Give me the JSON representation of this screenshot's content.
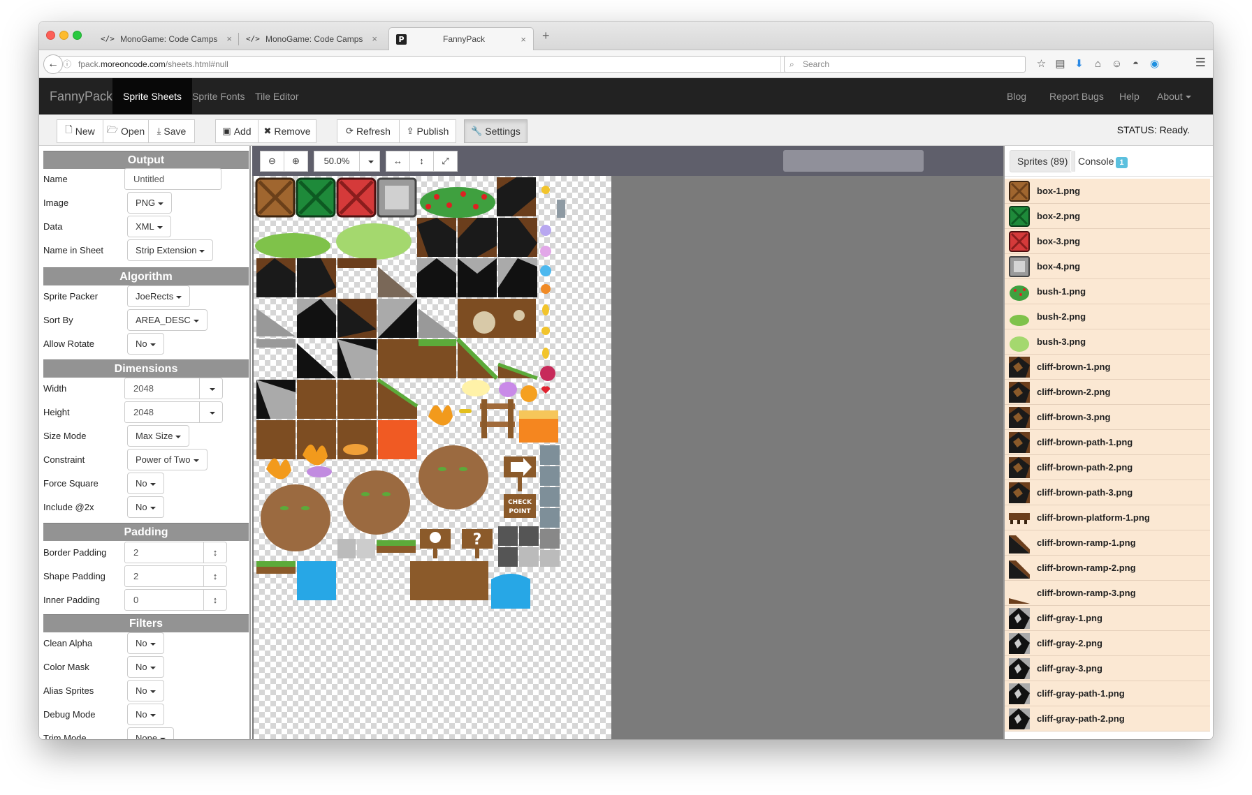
{
  "browser": {
    "tabs": [
      {
        "favicon": "</>",
        "title": "MonoGame: Code Camps",
        "close": "×"
      },
      {
        "favicon": "</>",
        "title": "MonoGame: Code Camps",
        "close": "×"
      },
      {
        "favicon": "P",
        "title": "FannyPack",
        "close": "×"
      }
    ],
    "new_tab": "+",
    "url_prefix": "fpack.",
    "url_domain": "moreoncode.com",
    "url_path": "/sheets.html#null",
    "search_placeholder": "Search"
  },
  "navbar": {
    "brand": "FannyPack",
    "items": [
      "Sprite Sheets",
      "Sprite Fonts",
      "Tile Editor"
    ],
    "right_items": [
      "Blog",
      "Report Bugs",
      "Help",
      "About"
    ]
  },
  "toolbar": {
    "buttons": [
      "New",
      "Open",
      "Save",
      "Add",
      "Remove",
      "Refresh",
      "Publish",
      "Settings"
    ],
    "status": "STATUS: Ready."
  },
  "output": {
    "heading": "Output",
    "name_label": "Name",
    "name_value": "Untitled",
    "image_label": "Image",
    "image_value": "PNG",
    "data_label": "Data",
    "data_value": "XML",
    "nis_label": "Name in Sheet",
    "nis_value": "Strip Extension"
  },
  "algorithm": {
    "heading": "Algorithm",
    "packer_label": "Sprite Packer",
    "packer_value": "JoeRects",
    "sort_label": "Sort By",
    "sort_value": "AREA_DESC",
    "rotate_label": "Allow Rotate",
    "rotate_value": "No"
  },
  "dimensions": {
    "heading": "Dimensions",
    "width_label": "Width",
    "width_value": "2048",
    "height_label": "Height",
    "height_value": "2048",
    "sizemode_label": "Size Mode",
    "sizemode_value": "Max Size",
    "constraint_label": "Constraint",
    "constraint_value": "Power of Two",
    "square_label": "Force Square",
    "square_value": "No",
    "x2_label": "Include @2x",
    "x2_value": "No"
  },
  "padding": {
    "heading": "Padding",
    "border_label": "Border Padding",
    "border_value": "2",
    "shape_label": "Shape Padding",
    "shape_value": "2",
    "inner_label": "Inner Padding",
    "inner_value": "0"
  },
  "filters": {
    "heading": "Filters",
    "clean_label": "Clean Alpha",
    "clean_value": "No",
    "mask_label": "Color Mask",
    "mask_value": "No",
    "alias_label": "Alias Sprites",
    "alias_value": "No",
    "debug_label": "Debug Mode",
    "debug_value": "No",
    "trim_label": "Trim Mode",
    "trim_value": "None"
  },
  "view": {
    "zoom": "50.0%"
  },
  "right_panel": {
    "sprites_tab": "Sprites (89)",
    "console_tab": "Console",
    "console_badge": "1",
    "sprites": [
      {
        "name": "box-1.png",
        "kind": "box-brown"
      },
      {
        "name": "box-2.png",
        "kind": "box-green"
      },
      {
        "name": "box-3.png",
        "kind": "box-red"
      },
      {
        "name": "box-4.png",
        "kind": "box-gray"
      },
      {
        "name": "bush-1.png",
        "kind": "bush-red"
      },
      {
        "name": "bush-2.png",
        "kind": "bush-green"
      },
      {
        "name": "bush-3.png",
        "kind": "bush-light"
      },
      {
        "name": "cliff-brown-1.png",
        "kind": "cliff-brown"
      },
      {
        "name": "cliff-brown-2.png",
        "kind": "cliff-brown"
      },
      {
        "name": "cliff-brown-3.png",
        "kind": "cliff-brown"
      },
      {
        "name": "cliff-brown-path-1.png",
        "kind": "cliff-brown"
      },
      {
        "name": "cliff-brown-path-2.png",
        "kind": "cliff-brown"
      },
      {
        "name": "cliff-brown-path-3.png",
        "kind": "cliff-brown"
      },
      {
        "name": "cliff-brown-platform-1.png",
        "kind": "platform-brown"
      },
      {
        "name": "cliff-brown-ramp-1.png",
        "kind": "ramp-brown"
      },
      {
        "name": "cliff-brown-ramp-2.png",
        "kind": "ramp-brown"
      },
      {
        "name": "cliff-brown-ramp-3.png",
        "kind": "ramp-brown-small"
      },
      {
        "name": "cliff-gray-1.png",
        "kind": "cliff-gray"
      },
      {
        "name": "cliff-gray-2.png",
        "kind": "cliff-gray"
      },
      {
        "name": "cliff-gray-3.png",
        "kind": "cliff-gray"
      },
      {
        "name": "cliff-gray-path-1.png",
        "kind": "cliff-gray"
      },
      {
        "name": "cliff-gray-path-2.png",
        "kind": "cliff-gray"
      }
    ]
  }
}
